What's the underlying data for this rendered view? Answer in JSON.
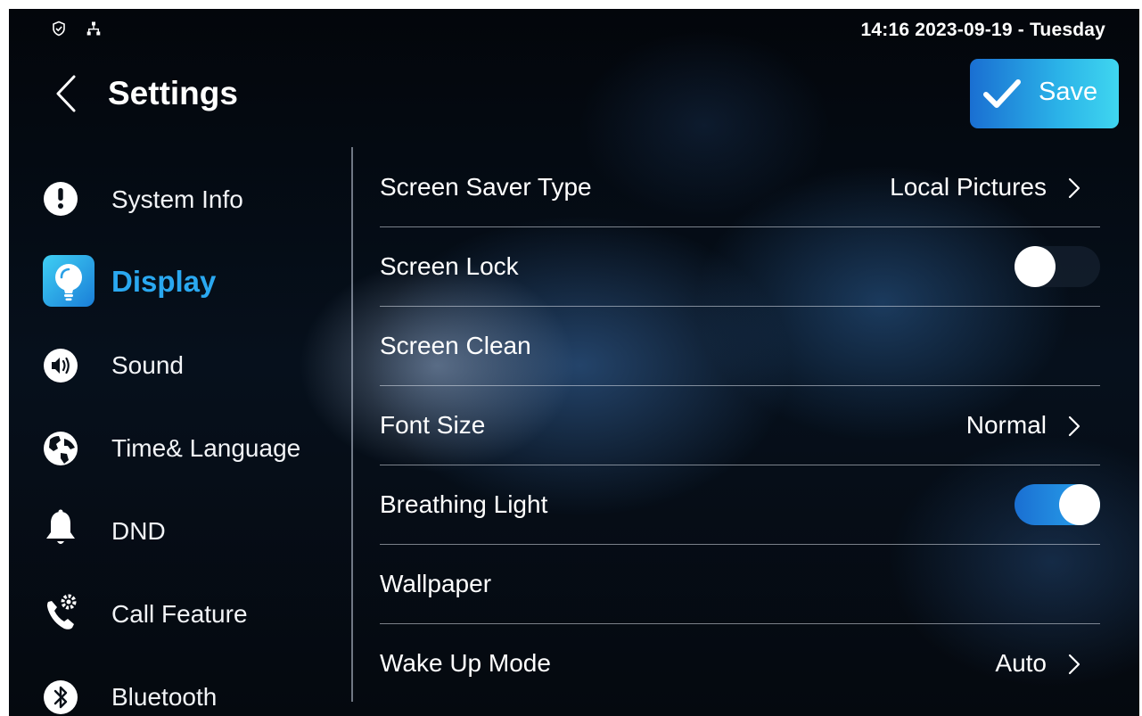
{
  "status_bar": {
    "clock": "14:16  2023-09-19 - Tuesday",
    "icons": [
      "shield-icon",
      "network-icon"
    ]
  },
  "header": {
    "title": "Settings",
    "save_label": "Save",
    "back_icon": "chevron-left-icon"
  },
  "colors": {
    "accent": "#2aa8f0",
    "save_gradient_start": "#1a6fd2",
    "save_gradient_end": "#3fd6f0"
  },
  "sidebar": {
    "items": [
      {
        "label": "System Info",
        "icon": "info-circle-icon",
        "active": false
      },
      {
        "label": "Display",
        "icon": "lightbulb-icon",
        "active": true
      },
      {
        "label": "Sound",
        "icon": "speaker-icon",
        "active": false
      },
      {
        "label": "Time& Language",
        "icon": "globe-icon",
        "active": false
      },
      {
        "label": "DND",
        "icon": "bell-icon",
        "active": false
      },
      {
        "label": "Call Feature",
        "icon": "phone-settings-icon",
        "active": false
      },
      {
        "label": "Bluetooth",
        "icon": "bluetooth-icon",
        "active": false
      }
    ]
  },
  "settings": {
    "rows": [
      {
        "label": "Screen Saver Type",
        "value": "Local Pictures",
        "control": "chevron"
      },
      {
        "label": "Screen Lock",
        "control": "toggle",
        "on": false
      },
      {
        "label": "Screen Clean",
        "control": "none"
      },
      {
        "label": "Font Size",
        "value": "Normal",
        "control": "chevron"
      },
      {
        "label": "Breathing Light",
        "control": "toggle",
        "on": true
      },
      {
        "label": "Wallpaper",
        "control": "none"
      },
      {
        "label": "Wake Up Mode",
        "value": "Auto",
        "control": "chevron"
      }
    ]
  }
}
